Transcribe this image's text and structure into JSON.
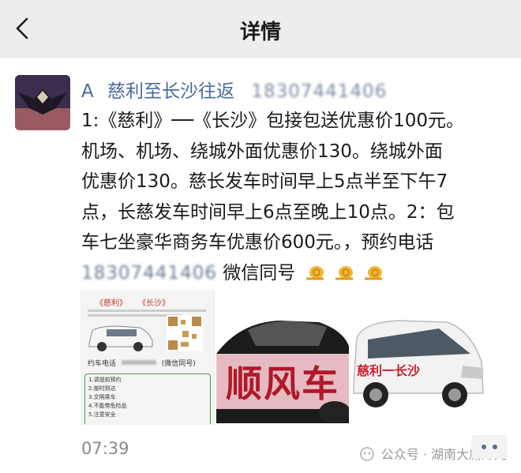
{
  "header": {
    "title": "详情"
  },
  "post": {
    "author_prefix": "A",
    "author_name": "慈利至长沙往返",
    "author_phone_blurred": "18307441406",
    "lines": [
      "1:《慈利》──《长沙》包接包送优惠价100元。",
      "机场、机场、绕城外面优惠价130。绕城外面",
      "优惠价130。慈长发车时间早上5点半至下午7",
      "点，长慈发车时间早上6点至晚上10点。2：包",
      "车七坐豪华商务车优惠价600元。，预约电话"
    ],
    "phone_blurred": "18307441406",
    "last_suffix": "微信同号",
    "time": "07:39"
  },
  "images": {
    "flyer": {
      "route_left": "《慈利》",
      "route_right": "《长沙》",
      "phone_label": "约车电话",
      "wechat": "(微信同号)",
      "notes": [
        "1.请提前预约",
        "2.按时到达",
        "3.文明乘车",
        "4.不能带危险品",
        "5.注意安全"
      ]
    },
    "banner": {
      "text": "顺风车"
    },
    "van": {
      "route": "慈利一长沙"
    }
  },
  "watermark": {
    "text": "公众号 · 湖南大庸妹儿"
  },
  "colors": {
    "name": "#4a6a9a",
    "topbar": "#ededed"
  }
}
